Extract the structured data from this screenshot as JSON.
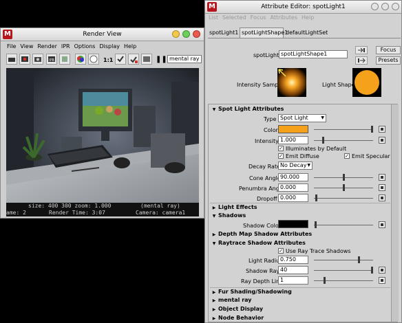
{
  "render_view": {
    "title": "Render View",
    "menu": [
      "File",
      "View",
      "Render",
      "IPR",
      "Options",
      "Display",
      "Help"
    ],
    "zoom_ratio": "1:1",
    "renderer_select": "mental ray",
    "image_stats_line": "size:  400  300 zoom: 1.000",
    "image_renderer": "(mental ray)",
    "frame_info": "ame: 2",
    "render_time": "Render Time:  3:07",
    "camera_info": "Camera: camera1"
  },
  "attribute_editor": {
    "title": "Attribute Editor: spotLight1",
    "menu": [
      "List",
      "Selected",
      "Focus",
      "Attributes",
      "Help"
    ],
    "tabs": [
      "spotLight1",
      "spotLightShape1",
      "defaultLightSet"
    ],
    "node_label": "spotLight:",
    "node_name": "spotLightShape1",
    "focus_button": "Focus",
    "presets_button": "Presets",
    "intensity_sample_label": "Intensity Sample",
    "light_shape_label": "Light Shape",
    "spot_section": "Spot Light Attributes",
    "type_label": "Type",
    "type_value": "Spot Light",
    "color_label": "Color",
    "color_value": "#f5a11b",
    "intensity_label": "Intensity",
    "intensity_value": "1.000",
    "illuminates_label": "Illuminates by Default",
    "emit_diffuse_label": "Emit Diffuse",
    "emit_specular_label": "Emit Specular",
    "decay_label": "Decay Rate",
    "decay_value": "No Decay",
    "cone_label": "Cone Angle",
    "cone_value": "90.000",
    "penumbra_label": "Penumbra Angle",
    "penumbra_value": "0.000",
    "dropoff_label": "Dropoff",
    "dropoff_value": "0.000",
    "light_effects_section": "Light Effects",
    "shadows_section": "Shadows",
    "shadow_color_label": "Shadow Color",
    "shadow_color_value": "#000000",
    "depth_map_section": "Depth Map Shadow Attributes",
    "raytrace_section": "Raytrace Shadow Attributes",
    "use_raytrace_label": "Use Ray Trace Shadows",
    "light_radius_label": "Light Radius",
    "light_radius_value": "0.750",
    "shadow_rays_label": "Shadow Rays",
    "shadow_rays_value": "40",
    "ray_depth_label": "Ray Depth Limit",
    "ray_depth_value": "1",
    "fur_section": "Fur Shading/Shadowing",
    "mental_ray_section": "mental ray",
    "object_display_section": "Object Display",
    "node_behavior_section": "Node Behavior"
  }
}
